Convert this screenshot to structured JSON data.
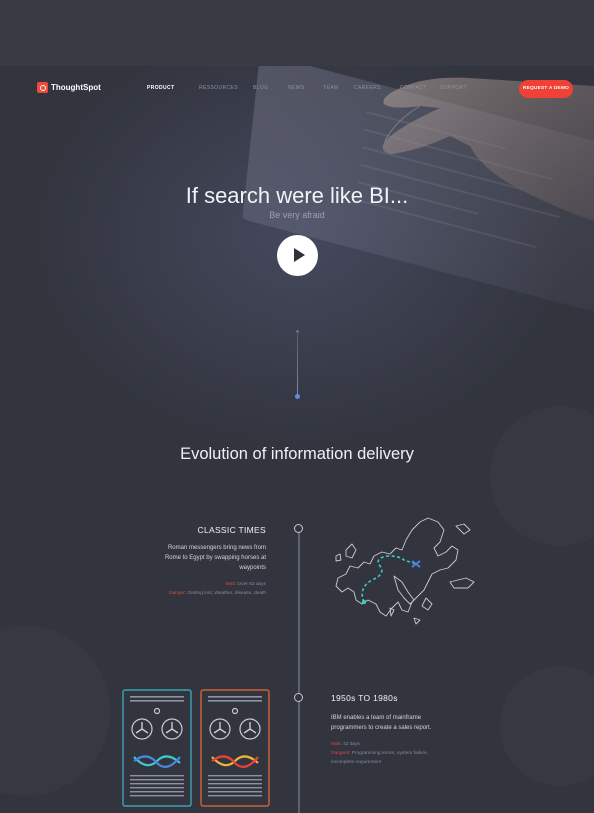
{
  "nav": {
    "logo_text": "ThoughtSpot",
    "items": [
      "PRODUCT",
      "RESSOURCES",
      "BLOG",
      "NEWS",
      "TEAM",
      "CAREERS",
      "CONTACT",
      "SUPPORT"
    ],
    "active_item": "PRODUCT",
    "cta_label": "REQUEST A DEMO"
  },
  "hero": {
    "title": "If search were like BI...",
    "subtitle": "Be very afraid"
  },
  "evolution": {
    "title": "Evolution of information delivery",
    "eras": [
      {
        "title": "CLASSIC TIMES",
        "description": "Roman messengers bring news from Rome to Egypt by swapping horses at waypoints",
        "wait_label": "Wait",
        "wait_value": ": Over 63 days",
        "danger_label": "Danger",
        "danger_value": ": Getting lost, Weather, disease, death"
      },
      {
        "title": "1950s TO 1980s",
        "description": "IBM enables a team of mainframe programmers to create a sales report.",
        "wait_label": "Wait",
        "wait_value": ": 42 days",
        "danger_label": "Dangers",
        "danger_value": ": Programming errors, system failure, incomplete requirement"
      }
    ]
  },
  "colors": {
    "accent": "#ef4136",
    "background": "#32353e",
    "route": "#3fc9c9",
    "highlight": "#5c8fd8"
  }
}
